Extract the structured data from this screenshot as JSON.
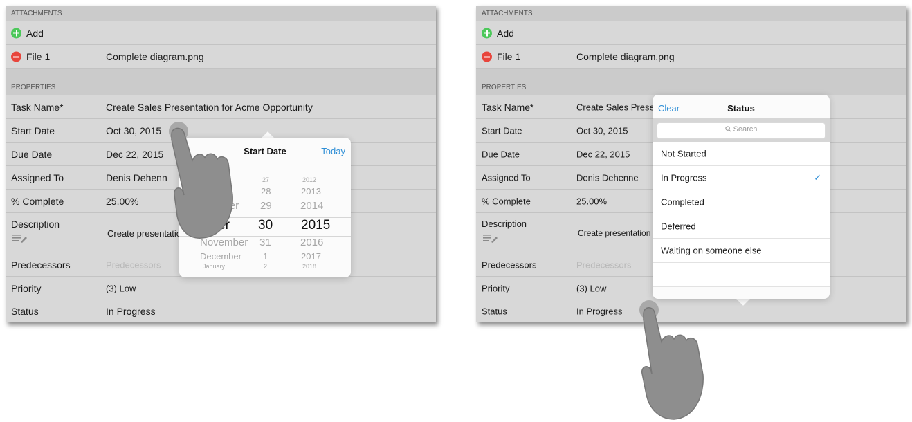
{
  "left": {
    "attachments_header": "ATTACHMENTS",
    "add_label": "Add",
    "file_label": "File 1",
    "file_value": "Complete diagram.png",
    "properties_header": "PROPERTIES",
    "rows": [
      {
        "label": "Task Name*",
        "value": "Create Sales Presentation for Acme Opportunity"
      },
      {
        "label": "Start Date",
        "value": "Oct 30, 2015"
      },
      {
        "label": "Due Date",
        "value": "Dec 22, 2015"
      },
      {
        "label": "Assigned To",
        "value": "Denis Dehenn"
      },
      {
        "label": "% Complete",
        "value": "25.00%"
      }
    ],
    "description_label": "Description",
    "description_value": "Create presentation",
    "predecessors_label": "Predecessors",
    "predecessors_placeholder": "Predecessors",
    "priority_label": "Priority",
    "priority_value": "(3) Low",
    "status_label": "Status",
    "status_value": "In Progress",
    "date_picker": {
      "title": "Start Date",
      "today_label": "Today",
      "months": [
        "r",
        "mber",
        "er",
        "November",
        "December",
        "January"
      ],
      "days": [
        "27",
        "28",
        "29",
        "30",
        "31",
        "1",
        "2"
      ],
      "years": [
        "2012",
        "2013",
        "2014",
        "2015",
        "2016",
        "2017",
        "2018"
      ]
    }
  },
  "right": {
    "attachments_header": "ATTACHMENTS",
    "add_label": "Add",
    "file_label": "File 1",
    "file_value": "Complete diagram.png",
    "properties_header": "PROPERTIES",
    "rows": [
      {
        "label": "Task Name*",
        "value": "Create Sales Prese"
      },
      {
        "label": "Start Date",
        "value": "Oct 30, 2015"
      },
      {
        "label": "Due Date",
        "value": "Dec 22, 2015"
      },
      {
        "label": "Assigned To",
        "value": "Denis Dehenne"
      },
      {
        "label": "% Complete",
        "value": "25.00%"
      }
    ],
    "description_label": "Description",
    "description_value": "Create presentation",
    "predecessors_label": "Predecessors",
    "predecessors_placeholder": "Predecessors",
    "priority_label": "Priority",
    "priority_value": "(3) Low",
    "status_label": "Status",
    "status_value": "In Progress",
    "status_picker": {
      "clear_label": "Clear",
      "title": "Status",
      "search_placeholder": "Search",
      "options": [
        "Not Started",
        "In Progress",
        "Completed",
        "Deferred",
        "Waiting on someone else"
      ],
      "selected": "In Progress",
      "check_mark": "✓"
    }
  },
  "icons": {
    "add": "plus-circle-icon",
    "remove": "minus-circle-icon",
    "description": "notes-pencil-icon",
    "search": "magnifier-icon",
    "touch": "hand-pointer-icon"
  },
  "colors": {
    "accent": "#2f8fd6",
    "add_green": "#4cc85a",
    "remove_red": "#e8453c",
    "panel_bg": "#d8d8d8"
  }
}
